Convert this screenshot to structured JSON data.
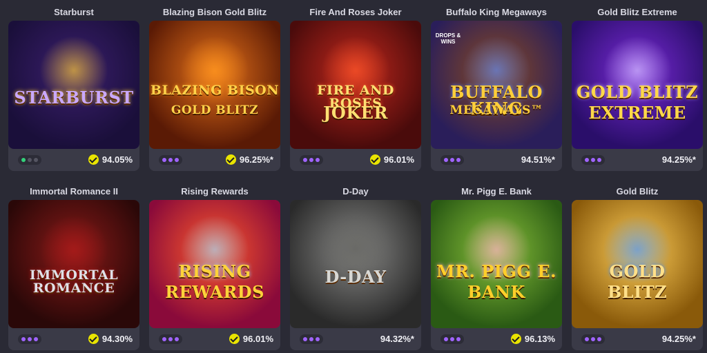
{
  "games": [
    {
      "title": "Starburst",
      "rtp": "94.05%",
      "verified": true,
      "dots_style": "live",
      "logo_text": "STARBURST",
      "colors": {
        "bg1": "#1a0f3a",
        "bg2": "#3b1f6e",
        "logo": "#c9a8ff",
        "accent": "#ffcc33"
      }
    },
    {
      "title": "Blazing Bison Gold Blitz",
      "rtp": "96.25%*",
      "verified": true,
      "dots_style": "purple",
      "logo_text": "BLAZING BISON",
      "sub_text": "GOLD BLITZ",
      "colors": {
        "bg1": "#5a1a05",
        "bg2": "#e8731a",
        "logo": "#ffd24a",
        "accent": "#ff9a1f"
      }
    },
    {
      "title": "Fire And Roses Joker",
      "rtp": "96.01%",
      "verified": true,
      "dots_style": "purple",
      "logo_text": "FIRE AND ROSES",
      "sub_text": "JOKER",
      "colors": {
        "bg1": "#4a0b0b",
        "bg2": "#c2281d",
        "logo": "#ffdf73",
        "accent": "#ff5a2a"
      }
    },
    {
      "title": "Buffalo King Megaways",
      "rtp": "94.51%*",
      "verified": false,
      "dots_style": "purple",
      "logo_text": "BUFFALO KING",
      "sub_text": "MEGAWAYS™",
      "badge_text": "DROPS & WINS",
      "colors": {
        "bg1": "#2a1e5a",
        "bg2": "#8a4a20",
        "logo": "#ffcf3a",
        "accent": "#5a8aff"
      }
    },
    {
      "title": "Gold Blitz Extreme",
      "rtp": "94.25%*",
      "verified": false,
      "dots_style": "purple",
      "logo_text": "GOLD BLITZ",
      "sub_text": "EXTREME",
      "colors": {
        "bg1": "#2a0e6a",
        "bg2": "#7a2ad8",
        "logo": "#ffd84a",
        "accent": "#d8c8ff"
      }
    },
    {
      "title": "Immortal Romance II",
      "rtp": "94.30%",
      "verified": true,
      "dots_style": "purple",
      "logo_text": "IMMORTAL ROMANCE",
      "colors": {
        "bg1": "#2a0808",
        "bg2": "#8a1a18",
        "logo": "#e0e0e8",
        "accent": "#b01a1a"
      }
    },
    {
      "title": "Rising Rewards",
      "rtp": "96.01%",
      "verified": true,
      "dots_style": "purple",
      "logo_text": "RISING",
      "sub_text": "REWARDS",
      "colors": {
        "bg1": "#8a0a3a",
        "bg2": "#ff5a2a",
        "logo": "#ffd23a",
        "accent": "#9ad8ff"
      }
    },
    {
      "title": "D-Day",
      "rtp": "94.32%*",
      "verified": false,
      "dots_style": "purple",
      "logo_text": "D-DAY",
      "colors": {
        "bg1": "#2a2a2a",
        "bg2": "#8a8a88",
        "logo": "#d8d8d4",
        "accent": "#5a5a56"
      }
    },
    {
      "title": "Mr. Pigg E. Bank",
      "rtp": "96.13%",
      "verified": true,
      "dots_style": "purple",
      "logo_text": "MR. PIGG E.",
      "sub_text": "BANK",
      "colors": {
        "bg1": "#2a5a14",
        "bg2": "#8ac23a",
        "logo": "#ffcf2a",
        "accent": "#ffa8c8"
      }
    },
    {
      "title": "Gold Blitz",
      "rtp": "94.25%*",
      "verified": false,
      "dots_style": "purple",
      "logo_text": "GOLD",
      "sub_text": "BLITZ",
      "colors": {
        "bg1": "#8a5a0a",
        "bg2": "#ffcf5a",
        "logo": "#ffe08a",
        "accent": "#3a8aff"
      }
    }
  ]
}
